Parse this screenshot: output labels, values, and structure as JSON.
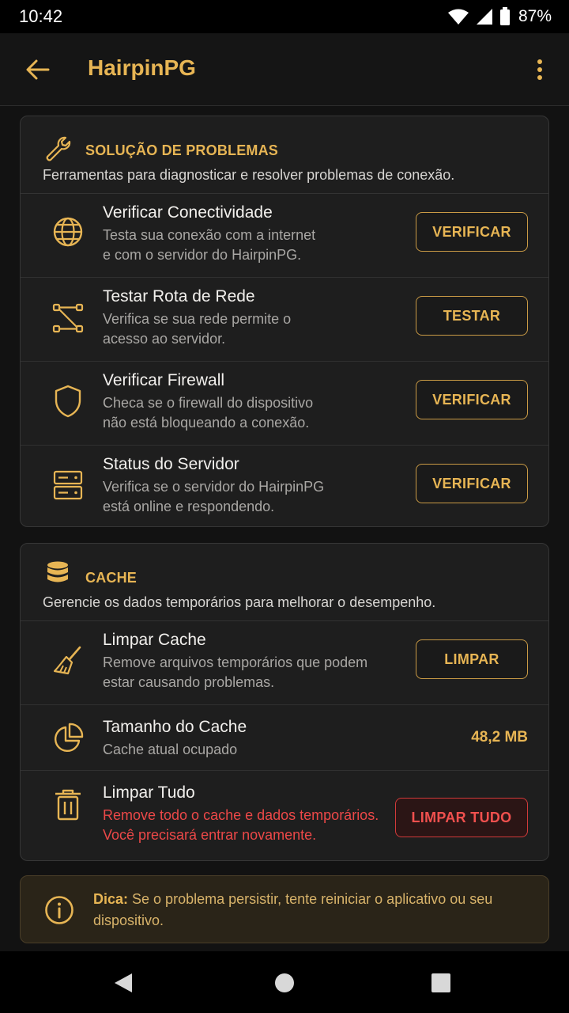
{
  "status": {
    "time": "10:42",
    "battery": "87%"
  },
  "appbar": {
    "title": "HairpinPG"
  },
  "troubleshoot": {
    "title": "SOLUÇÃO DE PROBLEMAS",
    "subtitle": "Ferramentas para diagnosticar e resolver problemas de conexão.",
    "items": [
      {
        "title": "Verificar Conectividade",
        "desc1": "Testa sua conexão com a internet",
        "desc2": "e com o servidor do HairpinPG.",
        "button": "VERIFICAR",
        "icon": "globe-icon"
      },
      {
        "title": "Testar Rota de Rede",
        "desc1": "Verifica se sua rede permite o",
        "desc2": "acesso ao servidor.",
        "button": "TESTAR",
        "icon": "network-route-icon"
      },
      {
        "title": "Verificar Firewall",
        "desc1": "Checa se o firewall do dispositivo",
        "desc2": "não está bloqueando a conexão.",
        "button": "VERIFICAR",
        "icon": "shield-icon"
      },
      {
        "title": "Status do Servidor",
        "desc1": "Verifica se o servidor do HairpinPG",
        "desc2": "está online e respondendo.",
        "button": "VERIFICAR",
        "icon": "server-icon"
      }
    ]
  },
  "cache": {
    "title": "CACHE",
    "subtitle": "Gerencie os dados temporários para melhorar o desempenho.",
    "clear": {
      "title": "Limpar Cache",
      "desc1": "Remove arquivos temporários que podem",
      "desc2": "estar causando problemas.",
      "button": "LIMPAR"
    },
    "size": {
      "title": "Tamanho do Cache",
      "desc": "Cache atual ocupado",
      "value": "48,2 MB"
    },
    "clear_all": {
      "title": "Limpar Tudo",
      "desc1": "Remove todo o cache e dados temporários.",
      "desc2": "Você precisará entrar novamente.",
      "button": "LIMPAR TUDO"
    }
  },
  "tip": {
    "label": "Dica:",
    "text": "Se o problema persistir, tente reiniciar o aplicativo ou seu dispositivo."
  },
  "colors": {
    "accent": "#e7b554",
    "danger": "#ec4848",
    "background": "#121212",
    "card": "#1e1e1e"
  }
}
